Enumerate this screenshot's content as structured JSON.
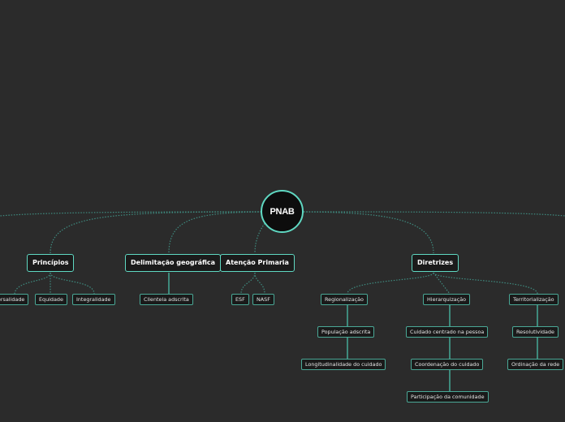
{
  "map": {
    "root": "PNAB",
    "principios": {
      "label": "Princípios",
      "children": [
        "ersalidade",
        "Equidade",
        "Integralidade"
      ]
    },
    "delimitacao": {
      "label": "Delimitação geográfica",
      "children": [
        "Clientela adscrita"
      ]
    },
    "atencao": {
      "label": "Atenção Primaria",
      "children": [
        "ESF",
        "NASF"
      ]
    },
    "diretrizes": {
      "label": "Diretrizes",
      "regionalizacao": {
        "label": "Regionalização",
        "children": [
          "População adscrita",
          "Longitudinalidade do cuidado"
        ]
      },
      "hierarquizacao": {
        "label": "Hierarquização",
        "children": [
          "Cuidado centrado na pessoa",
          "Coordenação do cuidado",
          "Participação da comunidade"
        ]
      },
      "territorializacao": {
        "label": "Territorialização",
        "children": [
          "Resolutividade",
          "Ordinação da rede"
        ]
      }
    }
  },
  "colors": {
    "background": "#2b2b2b",
    "accent": "#5fd8c2",
    "link_dotted": "#3f8c80",
    "link_solid": "#46b49f"
  }
}
